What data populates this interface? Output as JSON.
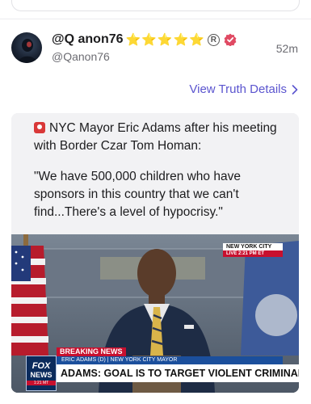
{
  "post": {
    "author_name": "@Q anon76",
    "name_emojis": "⭐⭐⭐⭐⭐",
    "registered_mark": "R",
    "handle": "@Qanon76",
    "timestamp": "52m",
    "details_link": "View Truth Details"
  },
  "media": {
    "headline_line": "NYC Mayor Eric Adams after his meeting with Border Czar Tom Homan:",
    "quote": "\"We have 500,000 children who have sponsors in this country that we can't find...There's a level of hypocrisy.\"",
    "video": {
      "location_bug": "NEW YORK CITY",
      "live_bug": "LIVE  2:21 PM ET",
      "network_logo_line1": "FOX",
      "network_logo_line2": "NEWS",
      "network_logo_line3": "1:21 MT",
      "banner_label": "BREAKING NEWS",
      "subtitle": "ERIC ADAMS (D) | NEW YORK CITY MAYOR",
      "headline": "ADAMS: GOAL IS TO TARGET VIOLENT CRIMINALS"
    }
  },
  "icons": [
    "star-emoji-icon",
    "registered-icon",
    "verified-badge-icon",
    "chevron-right-icon",
    "red-emoji-icon"
  ],
  "colors": {
    "link": "#5b55cf",
    "verified": "#e04a63",
    "breaking": "#c8102e",
    "fox_blue": "#1b4f9c"
  }
}
